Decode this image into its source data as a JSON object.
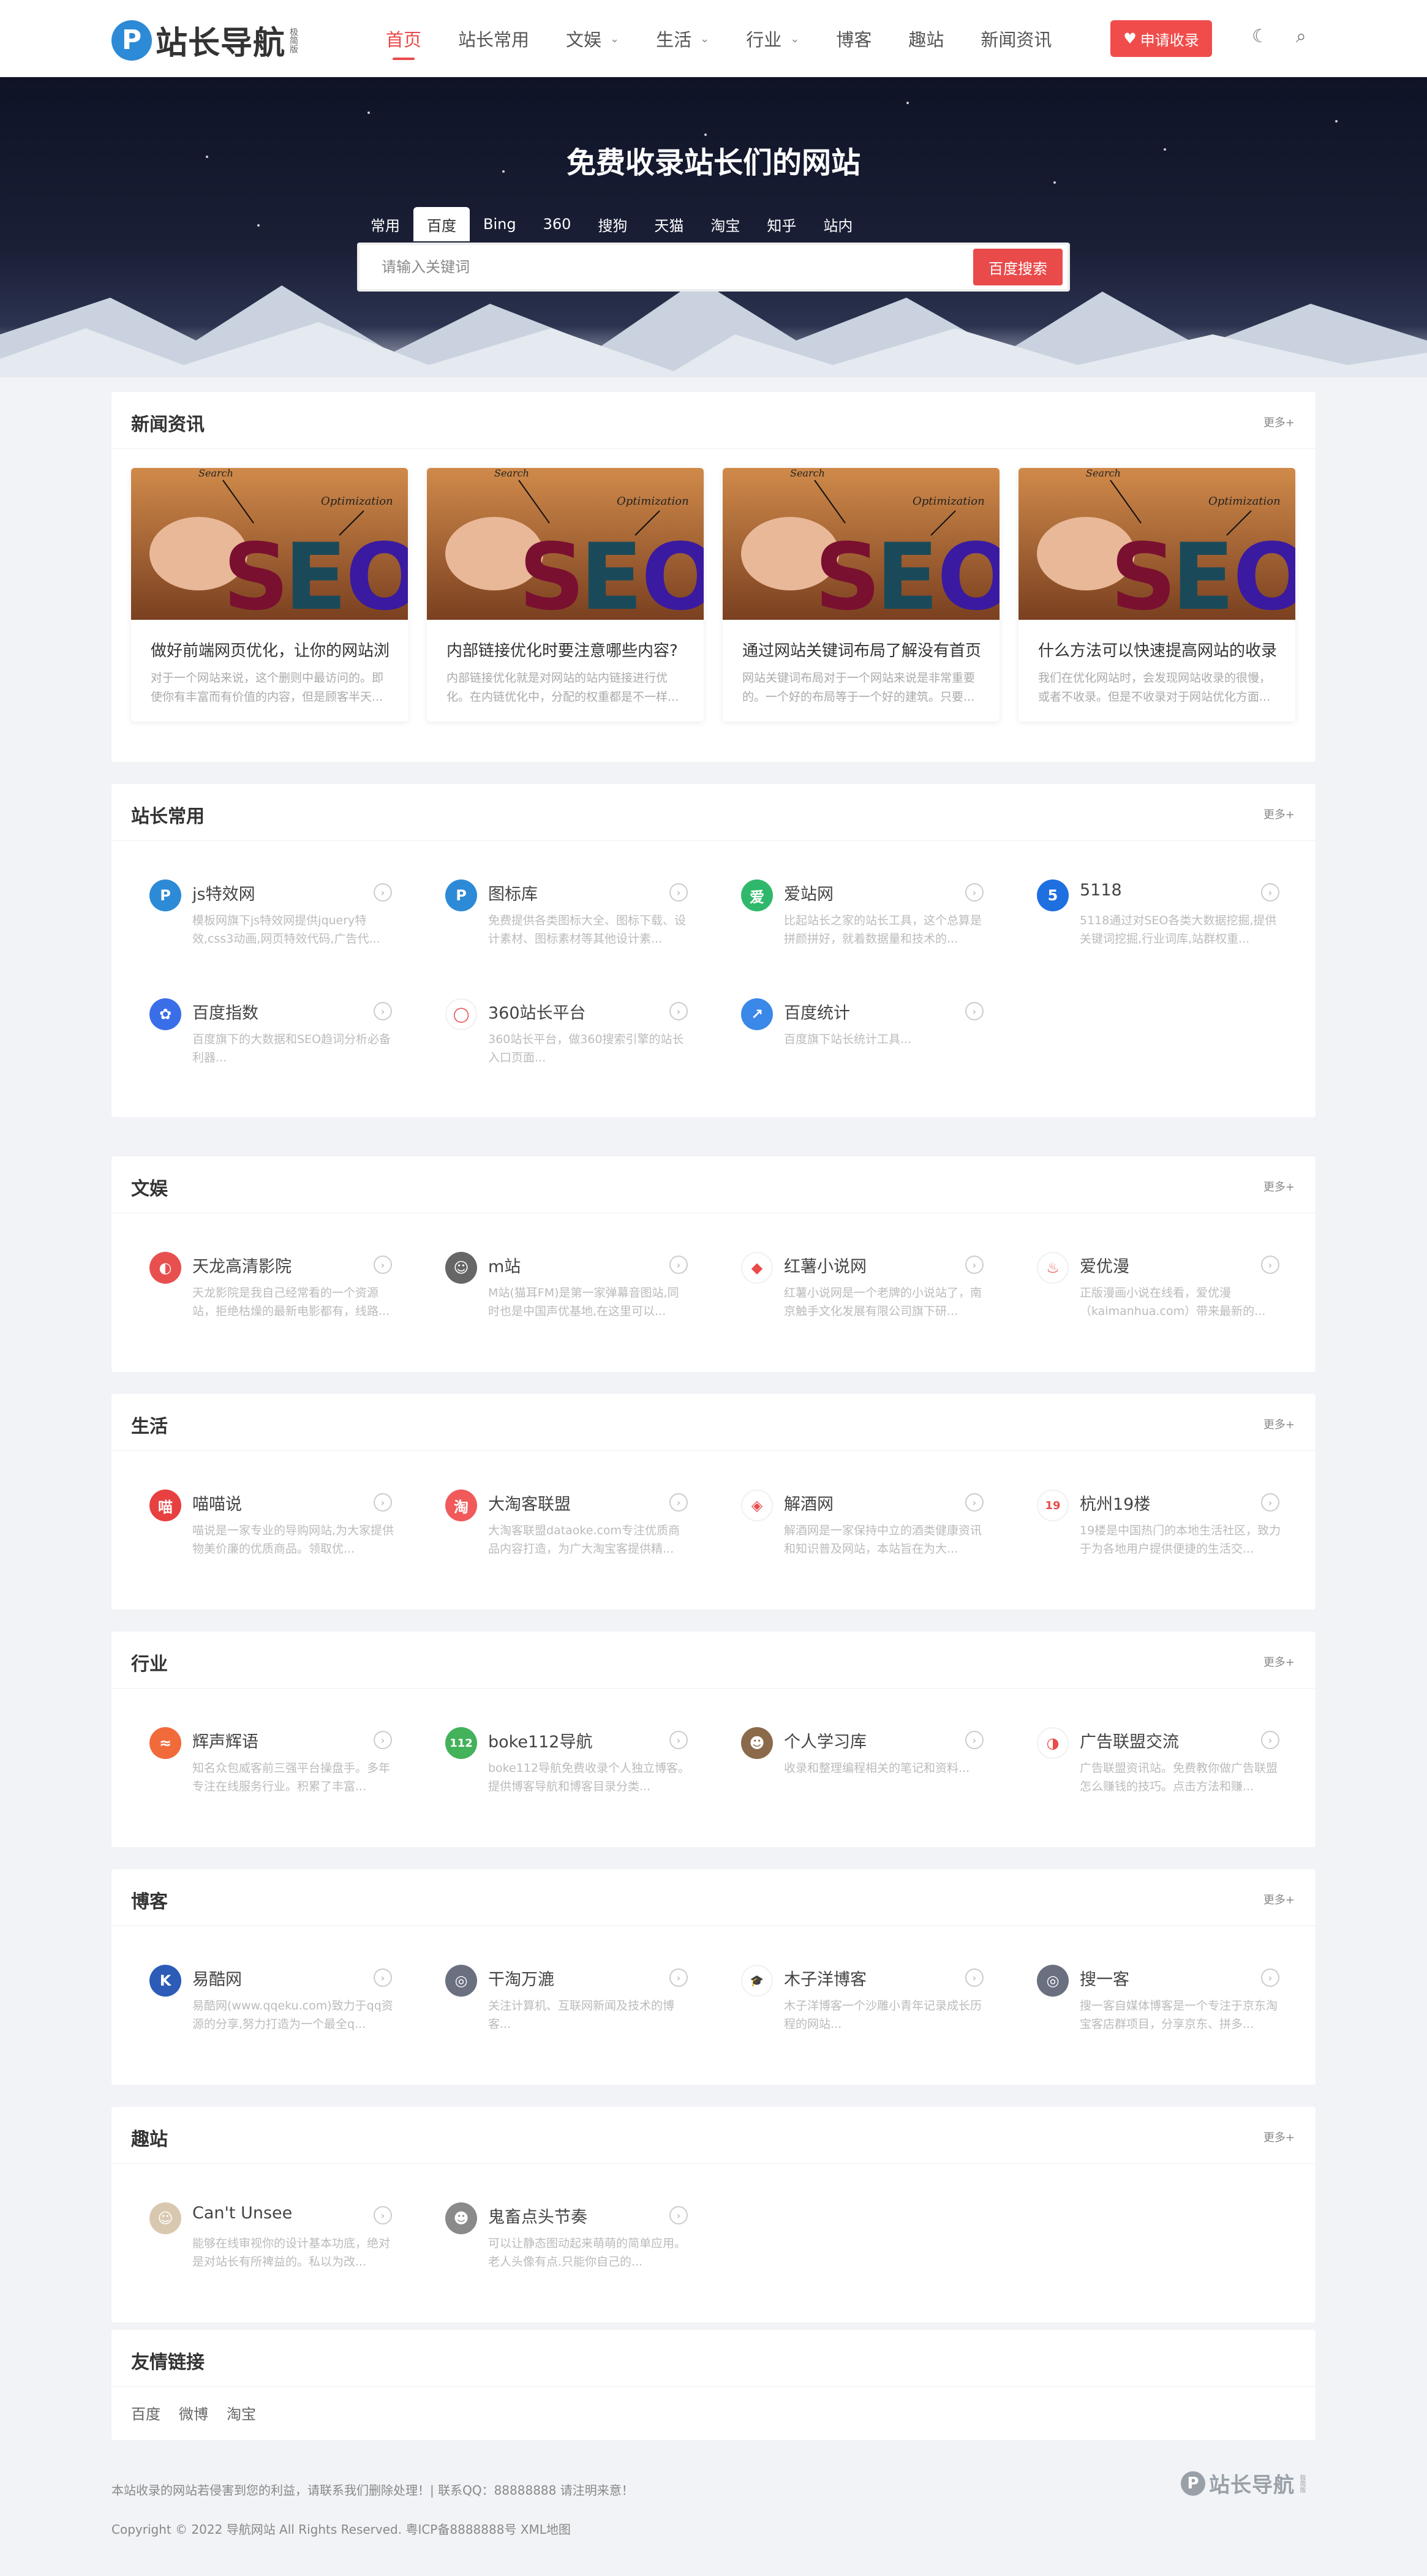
{
  "header": {
    "logo_letter": "P",
    "logo_text": "站长导航",
    "logo_sub": "极简版",
    "nav": [
      {
        "label": "首页",
        "active": true,
        "dropdown": false
      },
      {
        "label": "站长常用",
        "active": false,
        "dropdown": false
      },
      {
        "label": "文娱",
        "active": false,
        "dropdown": true
      },
      {
        "label": "生活",
        "active": false,
        "dropdown": true
      },
      {
        "label": "行业",
        "active": false,
        "dropdown": true
      },
      {
        "label": "博客",
        "active": false,
        "dropdown": false
      },
      {
        "label": "趣站",
        "active": false,
        "dropdown": false
      },
      {
        "label": "新闻资讯",
        "active": false,
        "dropdown": false
      }
    ],
    "apply_label": "申请收录",
    "moon_icon": "moon-icon",
    "search_icon": "search-icon"
  },
  "hero": {
    "title": "免费收录站长们的网站",
    "tabs": [
      "常用",
      "百度",
      "Bing",
      "360",
      "搜狗",
      "天猫",
      "淘宝",
      "知乎",
      "站内"
    ],
    "active_tab": "百度",
    "placeholder": "请输入关键词",
    "search_button": "百度搜索"
  },
  "news": {
    "title": "新闻资讯",
    "more": "更多+",
    "items": [
      {
        "title": "做好前端网页优化，让你的网站浏",
        "desc": "对于一个网站来说，这个删则中最访问的。即使你有丰富而有价值的内容，但是顾客半天..."
      },
      {
        "title": "内部链接优化时要注意哪些内容?",
        "desc": "内部链接优化就是对网站的站内链接进行优化。在内链优化中，分配的权重都是不一样..."
      },
      {
        "title": "通过网站关键词布局了解没有首页",
        "desc": "网站关键词布局对于一个网站来说是非常重要的。一个好的布局等于一个好的建筑。只要..."
      },
      {
        "title": "什么方法可以快速提高网站的收录",
        "desc": "我们在优化网站时，会发现网站收录的很慢，或者不收录。但是不收录对于网站优化方面..."
      }
    ]
  },
  "sections": [
    {
      "title": "站长常用",
      "more": "更多+",
      "sites": [
        {
          "name": "js特效网",
          "desc": "模板网旗下js特效网提供jquery特效,css3动画,网页特效代码,广告代...",
          "icon": "p-logo-icon",
          "color": "#2d8ad6",
          "glyph": "P"
        },
        {
          "name": "图标库",
          "desc": "免费提供各类图标大全、图标下载、设计素材、图标素材等其他设计素...",
          "icon": "p-logo-icon",
          "color": "#2d8ad6",
          "glyph": "P"
        },
        {
          "name": "爱站网",
          "desc": "比起站长之家的站长工具，这个总算是拼颜拼好，就着数据量和技术的...",
          "icon": "aizhan-icon",
          "color": "#2fb86b",
          "glyph": "爱"
        },
        {
          "name": "5118",
          "desc": "5118通过对SEO各类大数据挖掘,提供关键词挖掘,行业词库,站群权重...",
          "icon": "5118-icon",
          "color": "#1e6fe0",
          "glyph": "5"
        },
        {
          "name": "百度指数",
          "desc": "百度旗下的大数据和SEO趋词分析必备利器...",
          "icon": "baidu-paw-icon",
          "color": "#3a6ee8",
          "glyph": "✿"
        },
        {
          "name": "360站长平台",
          "desc": "360站长平台，做360搜索引擎的站长入口页面...",
          "icon": "360-icon",
          "color": "#ffffff",
          "glyph": "◯"
        },
        {
          "name": "百度统计",
          "desc": "百度旗下站长统计工具...",
          "icon": "stats-icon",
          "color": "#3a88e8",
          "glyph": "↗"
        }
      ]
    },
    {
      "title": "文娱",
      "more": "更多+",
      "sites": [
        {
          "name": "天龙高清影院",
          "desc": "天龙影院是我自己经常看的一个资源站，拒绝枯燥的最新电影都有，线路...",
          "icon": "film-icon",
          "color": "#e85050",
          "glyph": "◐"
        },
        {
          "name": "m站",
          "desc": "M站(猫耳FM)是第一家弹幕音图站,同时也是中国声优基地,在这里可以...",
          "icon": "cat-icon",
          "color": "#666666",
          "glyph": "☺"
        },
        {
          "name": "红薯小说网",
          "desc": "红薯小说网是一个老牌的小说站了，南京触手文化发展有限公司旗下研...",
          "icon": "sweet-potato-icon",
          "color": "#ffffff",
          "glyph": "◆"
        },
        {
          "name": "爱优漫",
          "desc": "正版漫画小说在线看，爱优漫（kaimanhua.com）带来最新的...",
          "icon": "manga-icon",
          "color": "#ffffff",
          "glyph": "♨"
        }
      ]
    },
    {
      "title": "生活",
      "more": "更多+",
      "sites": [
        {
          "name": "喵喵说",
          "desc": "喵说是一家专业的导购网站,为大家提供物美价廉的优质商品。领取优...",
          "icon": "miao-icon",
          "color": "#e84040",
          "glyph": "喵"
        },
        {
          "name": "大淘客联盟",
          "desc": "大淘客联盟dataoke.com专注优质商品内容打造，为广大淘宝客提供精...",
          "icon": "dataoke-icon",
          "color": "#f05a5a",
          "glyph": "淘"
        },
        {
          "name": "解酒网",
          "desc": "解酒网是一家保持中立的酒类健康资讯和知识普及网站，本站旨在为大...",
          "icon": "jiejiu-icon",
          "color": "#ffffff",
          "glyph": "◈"
        },
        {
          "name": "杭州19楼",
          "desc": "19楼是中国热门的本地生活社区，致力于为各地用户提供便捷的生活交...",
          "icon": "19lou-icon",
          "color": "#ffffff",
          "glyph": "19"
        }
      ]
    },
    {
      "title": "行业",
      "more": "更多+",
      "sites": [
        {
          "name": "辉声辉语",
          "desc": "知名众包威客前三强平台操盘手。多年专注在线服务行业。积累了丰富...",
          "icon": "hui-icon",
          "color": "#f06a3a",
          "glyph": "≈"
        },
        {
          "name": "boke112导航",
          "desc": "boke112导航免费收录个人独立博客。提供博客导航和博客目录分类...",
          "icon": "boke112-icon",
          "color": "#43b25a",
          "glyph": "112"
        },
        {
          "name": "个人学习库",
          "desc": "收录和整理编程相关的笔记和资料...",
          "icon": "study-icon",
          "color": "#8a6a4a",
          "glyph": "☻"
        },
        {
          "name": "广告联盟交流",
          "desc": "广告联盟资讯站。免费教你做广告联盟怎么赚钱的技巧。点击方法和赚...",
          "icon": "ad-icon",
          "color": "#ffffff",
          "glyph": "◑"
        }
      ]
    },
    {
      "title": "博客",
      "more": "更多+",
      "sites": [
        {
          "name": "易酷网",
          "desc": "易酷网(www.qqeku.com)致力于qq资源的分享,努力打造为一个最全q...",
          "icon": "yiku-icon",
          "color": "#2c5bb8",
          "glyph": "K"
        },
        {
          "name": "干淘万漉",
          "desc": "关注计算机、互联网新闻及技术的博客...",
          "icon": "gantao-icon",
          "color": "#6a7080",
          "glyph": "◎"
        },
        {
          "name": "木子洋博客",
          "desc": "木子洋博客一个沙雕小青年记录成长历程的网站...",
          "icon": "graduation-icon",
          "color": "#ffffff",
          "glyph": "🎓"
        },
        {
          "name": "搜一客",
          "desc": "搜一客自媒体博客是一个专注于京东淘宝客店群项目，分享京东、拼多...",
          "icon": "souyike-icon",
          "color": "#6a7080",
          "glyph": "◎"
        }
      ]
    },
    {
      "title": "趣站",
      "more": "更多+",
      "sites": [
        {
          "name": "Can't Unsee",
          "desc": "能够在线审视你的设计基本功底，绝对是对站长有所裨益的。私以为改...",
          "icon": "face-icon",
          "color": "#d9c8b0",
          "glyph": "☺"
        },
        {
          "name": "鬼畜点头节奏",
          "desc": "可以让静态图动起来萌萌的简单应用。老人头像有点.只能你自己的...",
          "icon": "old-man-icon",
          "color": "#8a8a8a",
          "glyph": "☻"
        }
      ]
    }
  ],
  "friend_links": {
    "title": "友情链接",
    "links": [
      "百度",
      "微博",
      "淘宝"
    ]
  },
  "footer": {
    "notice": "本站收录的网站若侵害到您的利益，请联系我们删除处理！| 联系QQ：88888888 请注明来意！",
    "copyright": "Copyright © 2022 导航网站 All Rights Reserved. 粤ICP备8888888号 XML地图",
    "logo_letter": "P",
    "logo_text": "站长导航",
    "logo_sub": "极简版"
  },
  "colors": {
    "accent": "#e94a4a",
    "brand": "#2d8ad6",
    "hero_bg": "#0f1326",
    "page_bg": "#f1f3f6"
  }
}
